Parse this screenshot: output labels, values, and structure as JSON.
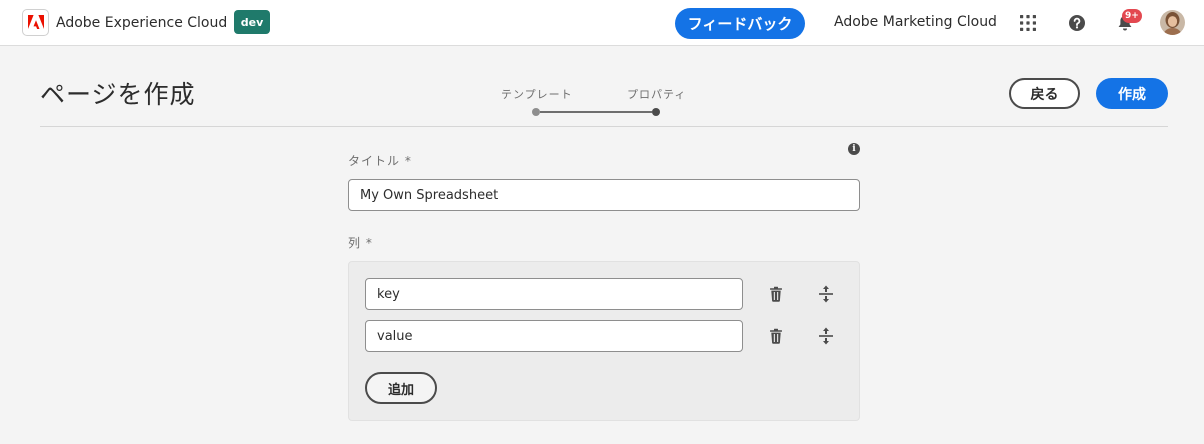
{
  "header": {
    "brand_name": "Adobe Experience Cloud",
    "environment_badge": "dev",
    "feedback_label": "フィードバック",
    "org_name": "Adobe Marketing Cloud",
    "notification_count": "9+",
    "icons": [
      "adobe-logo-icon",
      "apps-grid-icon",
      "help-icon",
      "bell-icon",
      "avatar"
    ]
  },
  "page": {
    "title": "ページを作成",
    "steps": [
      "テンプレート",
      "プロパティ"
    ],
    "active_step": 2,
    "back_label": "戻る",
    "create_label": "作成"
  },
  "form": {
    "title_label": "タイトル *",
    "title_value": "My Own Spreadsheet",
    "columns_label": "列 *",
    "columns": [
      {
        "value": "key"
      },
      {
        "value": "value"
      }
    ],
    "add_label": "追加"
  },
  "colors": {
    "accent": "#1473e6",
    "env_badge": "#1f7a6b",
    "notification": "#e34850",
    "brand_red": "#eb1000"
  }
}
